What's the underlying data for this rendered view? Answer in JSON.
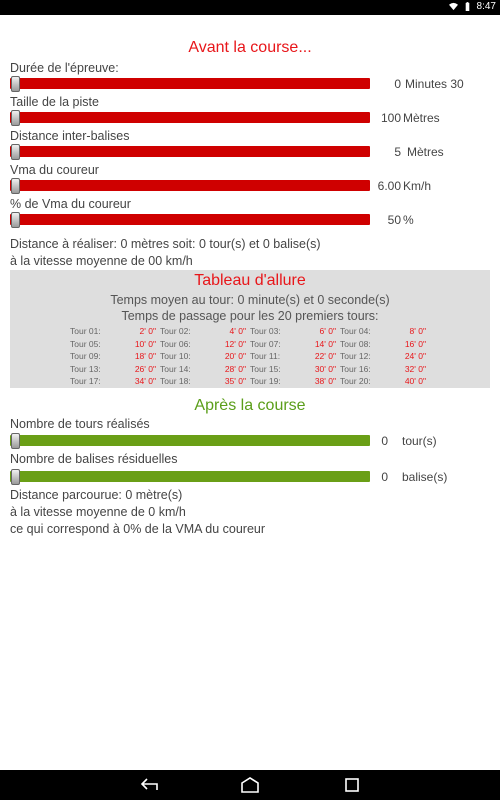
{
  "status_bar": {
    "time": "8:47"
  },
  "before": {
    "title": "Avant la course...",
    "sliders": [
      {
        "label": "Durée de l'épreuve:",
        "value": "0",
        "unit": "Minutes 30",
        "level": 0
      },
      {
        "label": "Taille de la piste",
        "value": "100",
        "unit": "Mètres",
        "level": 0
      },
      {
        "label": "Distance inter-balises",
        "value": "5",
        "unit": "Mètres",
        "level": 0
      },
      {
        "label": "Vma du coureur",
        "value": "6.00",
        "unit": "Km/h",
        "level": 0
      },
      {
        "label": "% de Vma du coureur",
        "value": "50",
        "unit": "%",
        "level": 0
      }
    ],
    "summary_line1": "Distance à réaliser: 0 mètres soit: 0 tour(s) et 0 balise(s)",
    "summary_line2": "à la vitesse moyenne de 00 km/h"
  },
  "tableau": {
    "title": "Tableau d'allure",
    "avg_time": "Temps moyen au tour: 0 minute(s) et 0 seconde(s)",
    "passage_title": "Temps de passage pour les 20 premiers tours:",
    "laps": [
      {
        "label": "Tour 01:",
        "time": "2' 0\""
      },
      {
        "label": "Tour 02:",
        "time": "4' 0\""
      },
      {
        "label": "Tour 03:",
        "time": "6' 0\""
      },
      {
        "label": "Tour 04:",
        "time": "8' 0\""
      },
      {
        "label": "Tour 05:",
        "time": "10' 0\""
      },
      {
        "label": "Tour 06:",
        "time": "12' 0\""
      },
      {
        "label": "Tour 07:",
        "time": "14' 0\""
      },
      {
        "label": "Tour 08:",
        "time": "16' 0\""
      },
      {
        "label": "Tour 09:",
        "time": "18' 0\""
      },
      {
        "label": "Tour 10:",
        "time": "20' 0\""
      },
      {
        "label": "Tour 11:",
        "time": "22' 0\""
      },
      {
        "label": "Tour 12:",
        "time": "24' 0\""
      },
      {
        "label": "Tour 13:",
        "time": "26' 0\""
      },
      {
        "label": "Tour 14:",
        "time": "28' 0\""
      },
      {
        "label": "Tour 15:",
        "time": "30' 0\""
      },
      {
        "label": "Tour 16:",
        "time": "32' 0\""
      },
      {
        "label": "Tour 17:",
        "time": "34' 0\""
      },
      {
        "label": "Tour 18:",
        "time": "35' 0\""
      },
      {
        "label": "Tour 19:",
        "time": "38' 0\""
      },
      {
        "label": "Tour 20:",
        "time": "40' 0\""
      }
    ]
  },
  "after": {
    "title": "Après la course",
    "sliders": [
      {
        "label": "Nombre de tours réalisés",
        "value": "0",
        "unit": "tour(s)",
        "level": 0
      },
      {
        "label": "Nombre de balises résiduelles",
        "value": "0",
        "unit": "balise(s)",
        "level": 0
      }
    ],
    "result_line1": "Distance parcourue: 0 mètre(s)",
    "result_line2": "à la vitesse moyenne de 0 km/h",
    "result_line3": "ce qui correspond à 0% de la VMA du coureur"
  },
  "icons": [
    "wifi-icon",
    "battery-icon",
    "back-icon",
    "home-icon",
    "recents-icon"
  ],
  "colors": {
    "accent_red": "#e8161a",
    "slider_red": "#cf0000",
    "accent_green": "#5b9e1a",
    "slider_green": "#6a9f16"
  }
}
